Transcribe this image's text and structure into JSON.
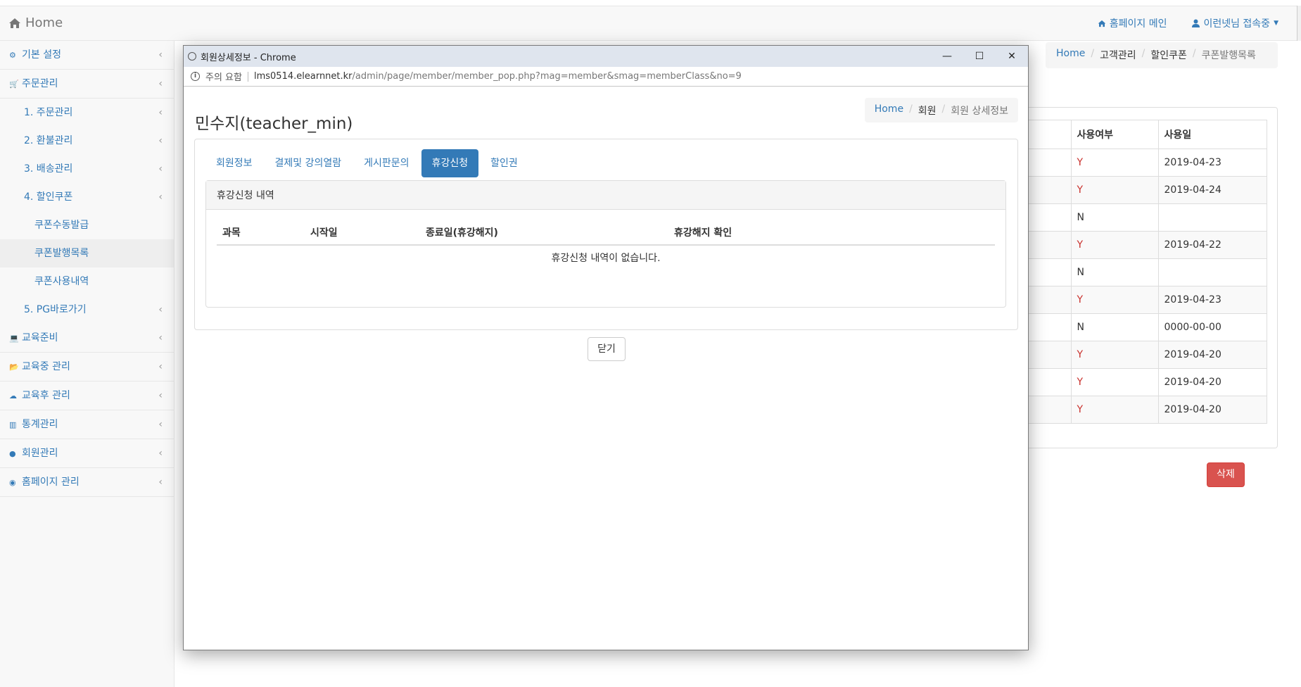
{
  "navbar": {
    "brand": "Home",
    "homepage_link": "홈페이지 메인",
    "user_menu": "이런넷님 접속중"
  },
  "sidebar": {
    "items": [
      {
        "label": "기본 설정",
        "icon": "gears-icon",
        "level": 0
      },
      {
        "label": "주문관리",
        "icon": "cart-icon",
        "level": 0
      },
      {
        "label": "1. 주문관리",
        "level": 1
      },
      {
        "label": "2. 환불관리",
        "level": 1
      },
      {
        "label": "3. 배송관리",
        "level": 1
      },
      {
        "label": "4. 할인쿠폰",
        "level": 1
      },
      {
        "label": "쿠폰수동발급",
        "level": 2
      },
      {
        "label": "쿠폰발행목록",
        "level": 2,
        "active": true
      },
      {
        "label": "쿠폰사용내역",
        "level": 2
      },
      {
        "label": "5. PG바로가기",
        "level": 1
      },
      {
        "label": "교육준비",
        "icon": "laptop-icon",
        "level": 0
      },
      {
        "label": "교육중 관리",
        "icon": "folder-open-icon",
        "level": 0
      },
      {
        "label": "교육후 관리",
        "icon": "cloud-upload-icon",
        "level": 0
      },
      {
        "label": "통계관리",
        "icon": "bar-chart-icon",
        "level": 0
      },
      {
        "label": "회원관리",
        "icon": "user-icon",
        "level": 0
      },
      {
        "label": "홈페이지 관리",
        "icon": "dashboard-icon",
        "level": 0
      }
    ]
  },
  "bg_breadcrumb": {
    "home": "Home",
    "level1": "고객관리",
    "level2": "할인쿠폰",
    "current": "쿠폰발행목록"
  },
  "bg_table": {
    "headers": [
      "사용여부",
      "사용일"
    ],
    "rows": [
      [
        "Y",
        "2019-04-23"
      ],
      [
        "Y",
        "2019-04-24"
      ],
      [
        "N",
        ""
      ],
      [
        "Y",
        "2019-04-22"
      ],
      [
        "N",
        ""
      ],
      [
        "Y",
        "2019-04-23"
      ],
      [
        "N",
        "0000-00-00"
      ],
      [
        "Y",
        "2019-04-20"
      ],
      [
        "Y",
        "2019-04-20"
      ],
      [
        "Y",
        "2019-04-20"
      ]
    ]
  },
  "bg_delete_button": "삭제",
  "popup": {
    "window_title": "회원상세정보 - Chrome",
    "security_label": "주의 요함",
    "url_host": "lms0514.elearnnet.kr",
    "url_path": "/admin/page/member/member_pop.php?mag=member&smag=memberClass&no=9",
    "title": "민수지(teacher_min)",
    "breadcrumb": {
      "home": "Home",
      "level1": "회원",
      "current": "회원 상세정보"
    },
    "tabs": [
      {
        "label": "회원정보",
        "active": false
      },
      {
        "label": "결제및 강의열람",
        "active": false
      },
      {
        "label": "게시판문의",
        "active": false
      },
      {
        "label": "휴강신청",
        "active": true
      },
      {
        "label": "할인권",
        "active": false
      }
    ],
    "panel_heading": "휴강신청 내역",
    "table_headers": [
      "과목",
      "시작일",
      "종료일(휴강해지)",
      "휴강해지 확인"
    ],
    "empty_message": "휴강신청 내역이 없습니다.",
    "close_button": "닫기"
  }
}
